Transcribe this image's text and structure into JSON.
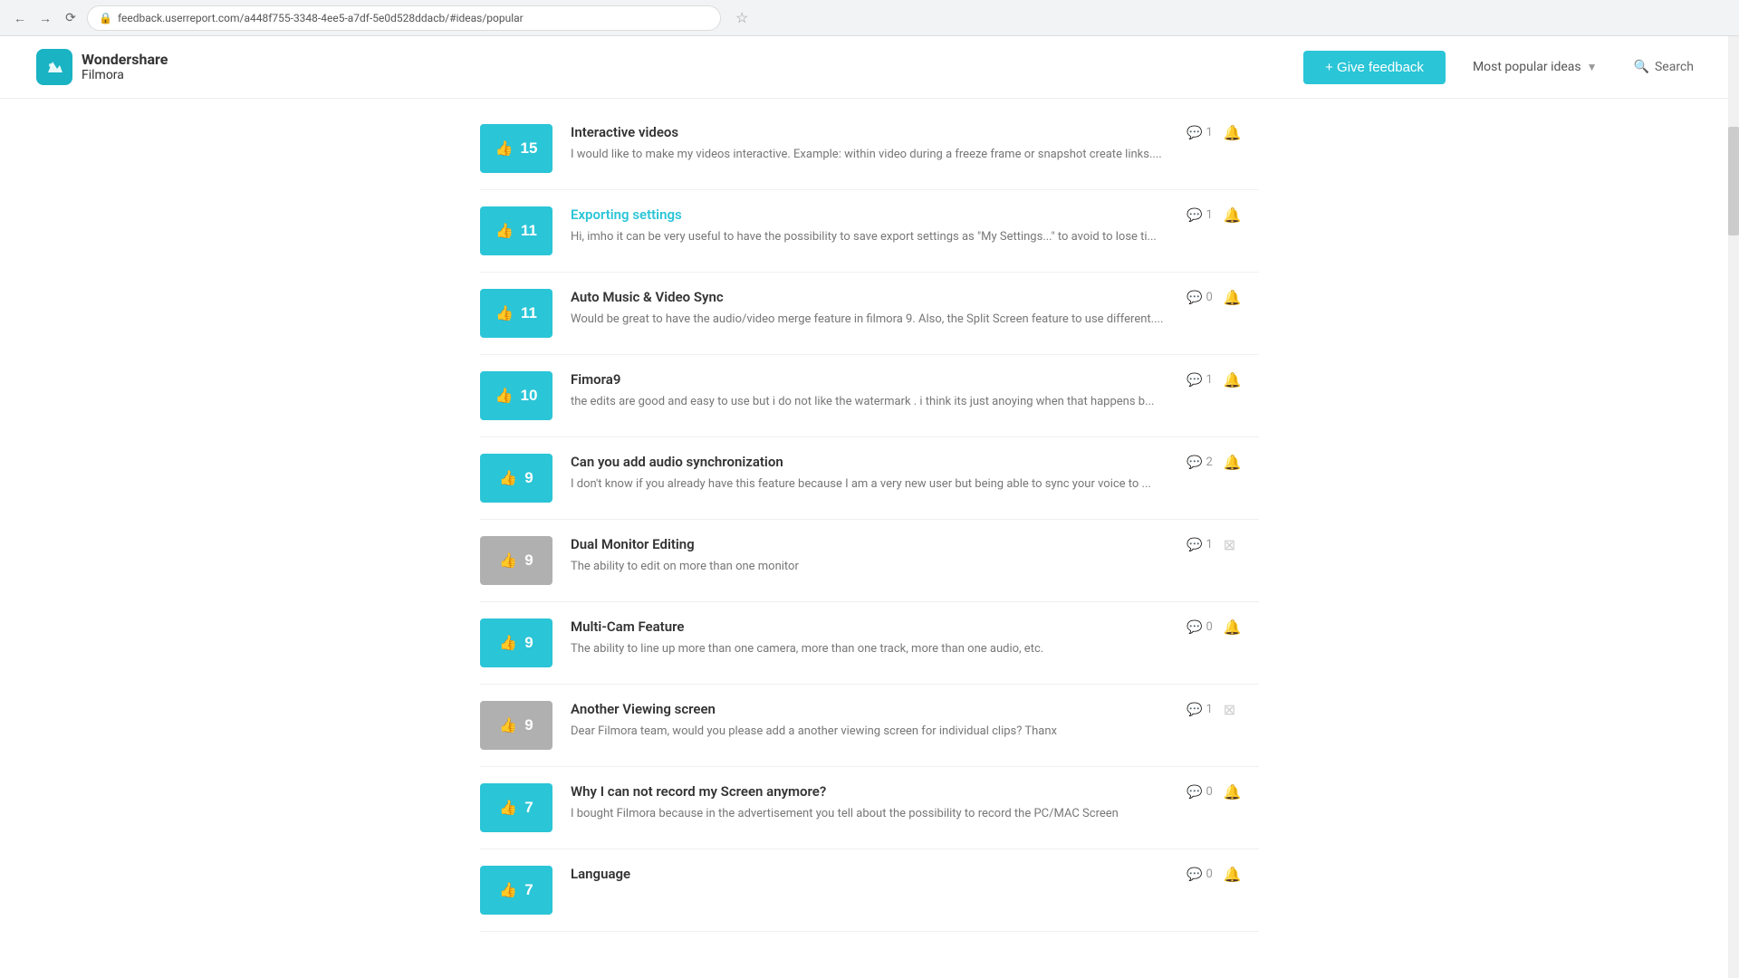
{
  "browser": {
    "url": "feedback.userreport.com/a448f755-3348-4ee5-a7df-5e0d528ddacb/#ideas/popular"
  },
  "header": {
    "logo_brand": "Wondershare",
    "logo_product": "Filmora",
    "give_feedback_label": "+ Give feedback",
    "sort_label": "Most popular ideas",
    "search_label": "Search"
  },
  "ideas": [
    {
      "id": 1,
      "votes": 15,
      "active": true,
      "title": "Interactive videos",
      "title_link": false,
      "description": "I would like to make my videos interactive. Example: within video during a freeze frame or snapshot create links....",
      "comments": 1,
      "bell_state": "inactive",
      "special_icon": "none"
    },
    {
      "id": 2,
      "votes": 11,
      "active": true,
      "title": "Exporting settings",
      "title_link": true,
      "description": "Hi, imho it can be very useful to have the possibility to save export settings as \"My Settings...\" to avoid to lose ti...",
      "comments": 1,
      "bell_state": "inactive",
      "special_icon": "none"
    },
    {
      "id": 3,
      "votes": 11,
      "active": true,
      "title": "Auto Music & Video Sync",
      "title_link": false,
      "description": "Would be great to have the audio/video merge feature in filmora 9. Also, the Split Screen feature to use different....",
      "comments": 0,
      "bell_state": "active",
      "special_icon": "none"
    },
    {
      "id": 4,
      "votes": 10,
      "active": true,
      "title": "Fimora9",
      "title_link": false,
      "description": "the edits are good and easy to use but i do not like the watermark . i think its just anoying when that happens b...",
      "comments": 1,
      "bell_state": "inactive",
      "special_icon": "none"
    },
    {
      "id": 5,
      "votes": 9,
      "active": true,
      "title": "Can you add audio synchronization",
      "title_link": false,
      "description": "I don't know if you already have this feature because I am a very new user but being able to sync your voice to ...",
      "comments": 2,
      "bell_state": "inactive",
      "special_icon": "none"
    },
    {
      "id": 6,
      "votes": 9,
      "active": false,
      "title": "Dual Monitor Editing",
      "title_link": false,
      "description": "The ability to edit on more than one monitor",
      "comments": 1,
      "bell_state": "inactive",
      "special_icon": "hourglass"
    },
    {
      "id": 7,
      "votes": 9,
      "active": true,
      "title": "Multi-Cam Feature",
      "title_link": false,
      "description": "The ability to line up more than one camera, more than one track, more than one audio, etc.",
      "comments": 0,
      "bell_state": "inactive",
      "special_icon": "none"
    },
    {
      "id": 8,
      "votes": 9,
      "active": false,
      "title": "Another Viewing screen",
      "title_link": false,
      "description": "Dear Filmora team, would you please add a another viewing screen for individual clips? Thanx",
      "comments": 1,
      "bell_state": "inactive",
      "special_icon": "hourglass"
    },
    {
      "id": 9,
      "votes": 7,
      "active": true,
      "title": "Why I can not record my Screen anymore?",
      "title_link": false,
      "description": "I bought Filmora because in the advertisement you tell about the possibility to record the PC/MAC Screen",
      "comments": 0,
      "bell_state": "inactive",
      "special_icon": "none"
    },
    {
      "id": 10,
      "votes": 7,
      "active": true,
      "title": "Language",
      "title_link": false,
      "description": "",
      "comments": 0,
      "bell_state": "inactive",
      "special_icon": "none"
    }
  ]
}
